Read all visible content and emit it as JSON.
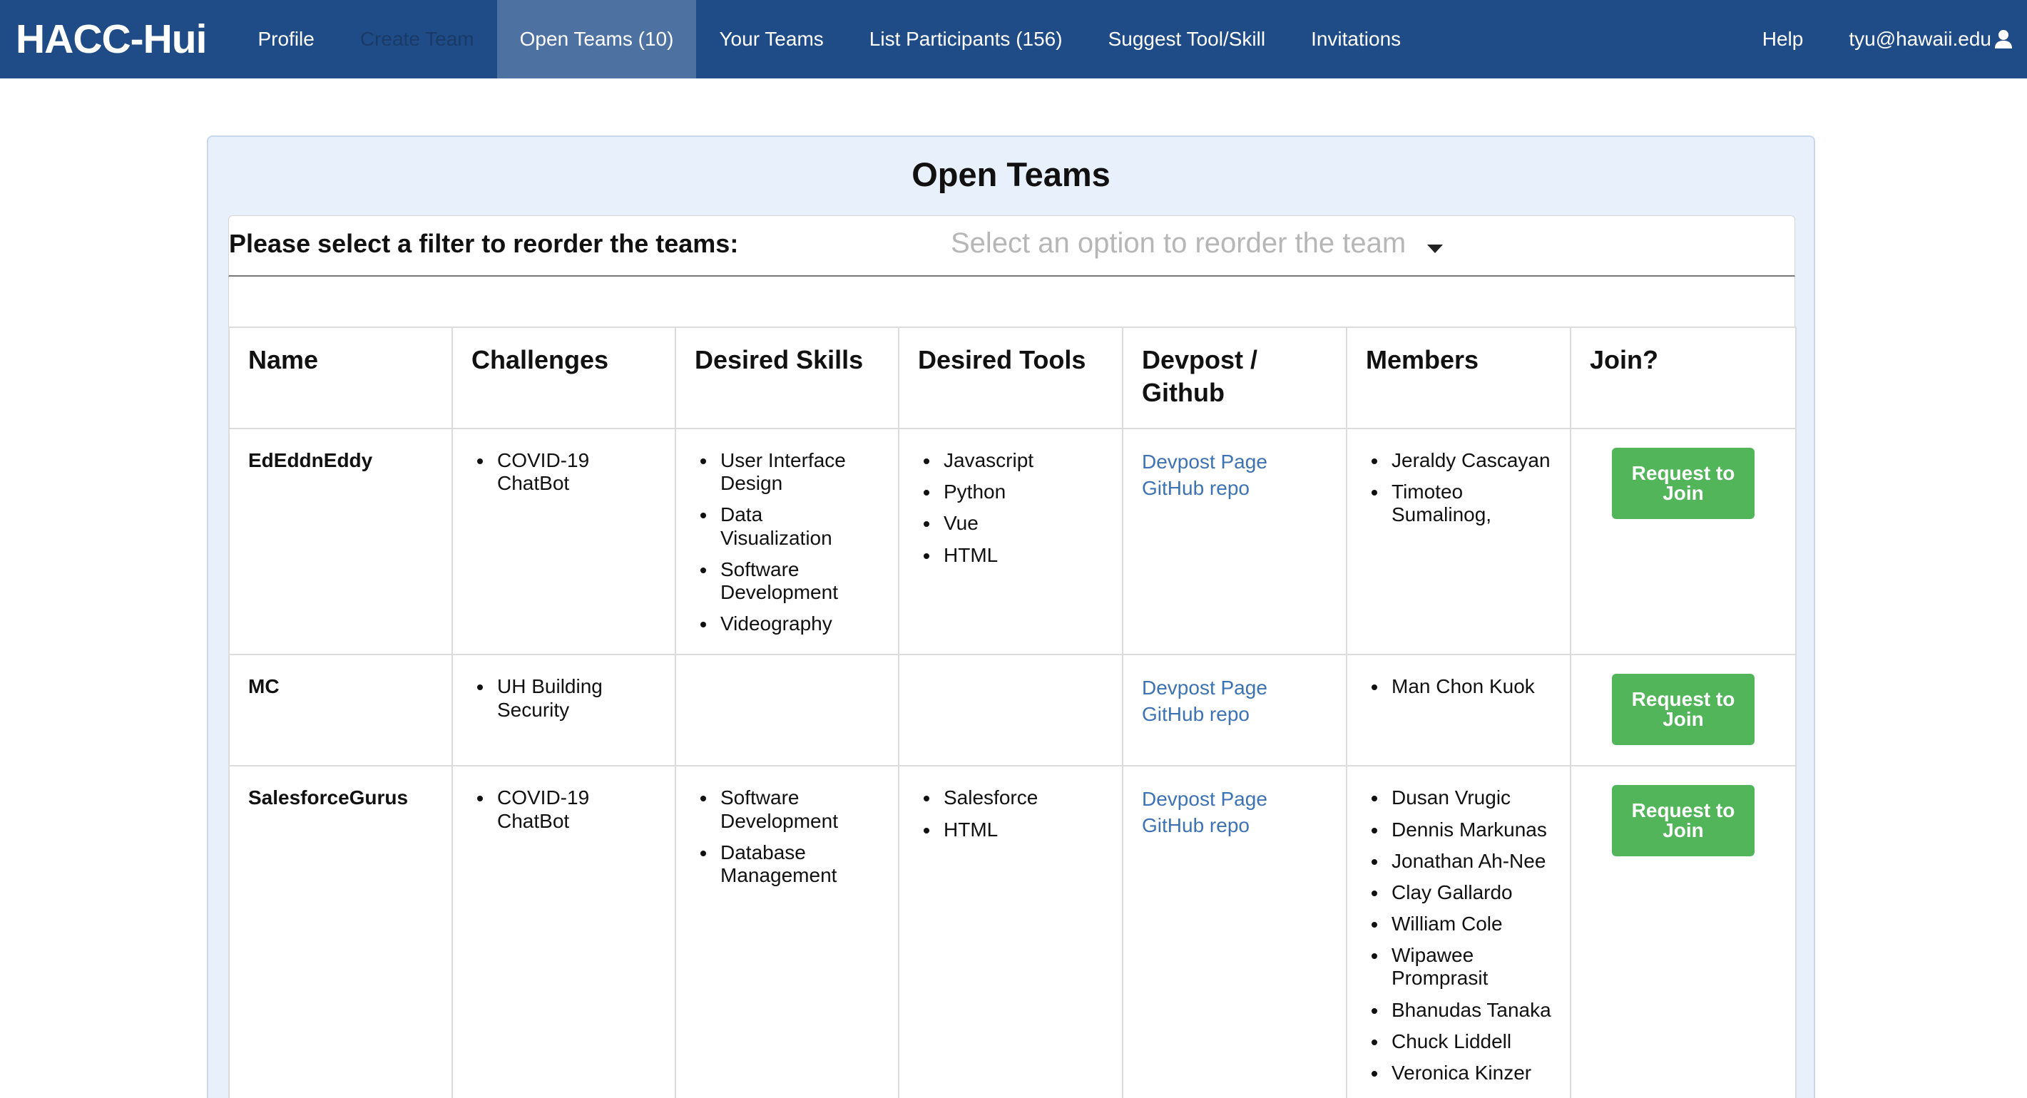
{
  "navbar": {
    "brand": "HACC-Hui",
    "items": [
      {
        "label": "Profile"
      },
      {
        "label": "Create Team"
      },
      {
        "label": "Open Teams (10)"
      },
      {
        "label": "Your Teams"
      },
      {
        "label": "List Participants (156)"
      },
      {
        "label": "Suggest Tool/Skill"
      },
      {
        "label": "Invitations"
      }
    ],
    "help": "Help",
    "user": "tyu@hawaii.edu",
    "user_icon": "user-icon",
    "active_item": "Open Teams (10)"
  },
  "page": {
    "title": "Open Teams",
    "filter_label": "Please select a filter to reorder the teams:",
    "filter_placeholder": "Select an option to reorder the team"
  },
  "table": {
    "headers": [
      "Name",
      "Challenges",
      "Desired Skills",
      "Desired Tools",
      "Devpost / Github",
      "Members",
      "Join?"
    ],
    "rows": [
      {
        "name": "EdEddnEddy",
        "challenges": [
          "COVID-19 ChatBot"
        ],
        "skills": [
          "User Interface Design",
          "Data Visualization",
          "Software Development",
          "Videography"
        ],
        "tools": [
          "Javascript",
          "Python",
          "Vue",
          "HTML"
        ],
        "devpost": "Devpost Page",
        "github": "GitHub repo",
        "members": [
          "Jeraldy Cascayan",
          "Timoteo Sumalinog,"
        ],
        "join": "Request to Join"
      },
      {
        "name": "MC",
        "challenges": [
          "UH Building Security"
        ],
        "skills": [],
        "tools": [],
        "devpost": "Devpost Page",
        "github": "GitHub repo",
        "members": [
          "Man Chon Kuok"
        ],
        "join": "Request to Join"
      },
      {
        "name": "SalesforceGurus",
        "challenges": [
          "COVID-19 ChatBot"
        ],
        "skills": [
          "Software Development",
          "Database Management"
        ],
        "tools": [
          "Salesforce",
          "HTML"
        ],
        "devpost": "Devpost Page",
        "github": "GitHub repo",
        "members": [
          "Dusan Vrugic",
          "Dennis Markunas",
          "Jonathan Ah-Nee",
          "Clay Gallardo",
          "William Cole",
          "Wipawee Promprasit",
          "Bhanudas Tanaka",
          "Chuck Liddell",
          "Veronica Kinzer"
        ],
        "join": "Request to Join"
      }
    ]
  },
  "colors": {
    "navbar": "#1f4c87",
    "navbar_active": "#4d71a1",
    "card_background": "#e7f0fb",
    "link": "#3d72b4",
    "join_button": "#52b55a"
  }
}
